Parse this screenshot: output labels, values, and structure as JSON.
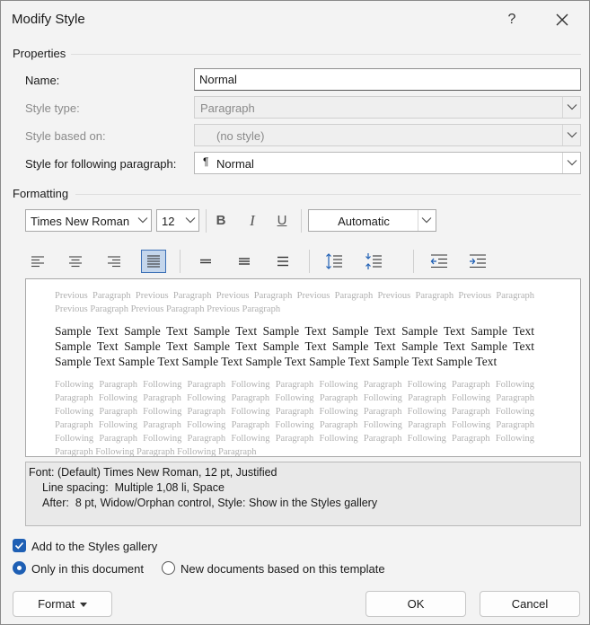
{
  "window": {
    "title": "Modify Style",
    "help_label": "?"
  },
  "properties": {
    "section_label": "Properties",
    "name_label": "Name:",
    "name_value": "Normal",
    "style_type_label": "Style type:",
    "style_type_value": "Paragraph",
    "style_based_on_label": "Style based on:",
    "style_based_on_value": "(no style)",
    "following_label": "Style for following paragraph:",
    "following_mark": "¶",
    "following_value": "Normal"
  },
  "formatting": {
    "section_label": "Formatting",
    "font_name": "Times New Roman",
    "font_size": "12",
    "bold_label": "B",
    "italic_label": "I",
    "underline_label": "U",
    "font_color": "Automatic",
    "active_alignment": "justify"
  },
  "preview": {
    "previous_text": "Previous Paragraph Previous Paragraph Previous Paragraph Previous Paragraph Previous Paragraph Previous Paragraph Previous Paragraph Previous Paragraph Previous Paragraph",
    "sample_text": "Sample Text Sample Text Sample Text Sample Text Sample Text Sample Text Sample Text Sample Text Sample Text Sample Text Sample Text Sample Text Sample Text Sample Text Sample Text Sample Text Sample Text Sample Text Sample Text Sample Text Sample Text",
    "following_text": "Following Paragraph Following Paragraph Following Paragraph Following Paragraph Following Paragraph Following Paragraph Following Paragraph Following Paragraph Following Paragraph Following Paragraph Following Paragraph Following Paragraph Following Paragraph Following Paragraph Following Paragraph Following Paragraph Following Paragraph Following Paragraph Following Paragraph Following Paragraph Following Paragraph Following Paragraph Following Paragraph Following Paragraph Following Paragraph Following Paragraph Following Paragraph Following Paragraph Following Paragraph Following Paragraph"
  },
  "description": {
    "line1": "Font: (Default) Times New Roman, 12 pt, Justified",
    "line2": "Line spacing:  Multiple 1,08 li, Space",
    "line3": "After:  8 pt, Widow/Orphan control, Style: Show in the Styles gallery"
  },
  "options": {
    "add_to_gallery_label": "Add to the Styles gallery",
    "add_to_gallery_checked": true,
    "only_this_document_label": "Only in this document",
    "new_documents_label": "New documents based on this template",
    "selected_scope": "only_this_document"
  },
  "buttons": {
    "format_label": "Format",
    "ok_label": "OK",
    "cancel_label": "Cancel"
  },
  "colors": {
    "accent": "#1e5fb4",
    "dialog_bg": "#f3f3f3"
  }
}
